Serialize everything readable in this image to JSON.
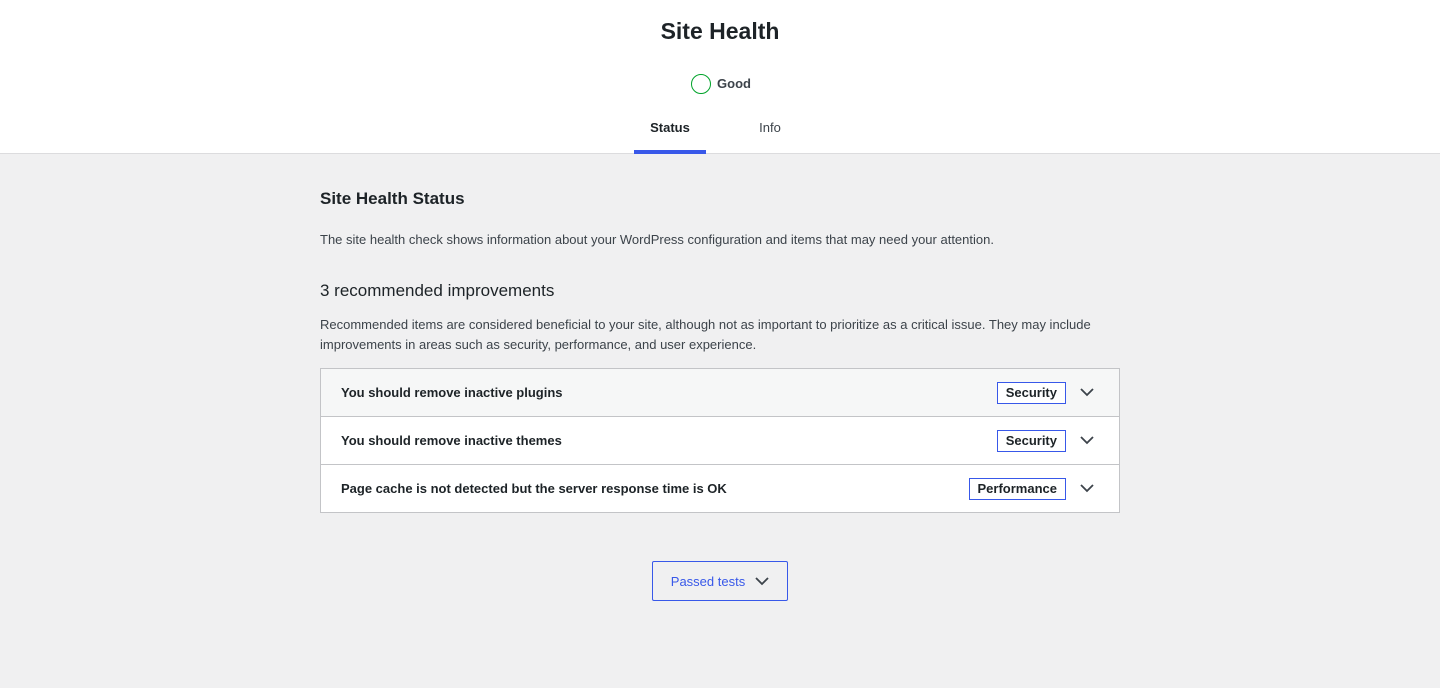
{
  "header": {
    "title": "Site Health",
    "health_status": "Good",
    "health_color": "#00a32a"
  },
  "tabs": [
    {
      "label": "Status",
      "active": true
    },
    {
      "label": "Info",
      "active": false
    }
  ],
  "status": {
    "title": "Site Health Status",
    "description": "The site health check shows information about your WordPress configuration and items that may need your attention."
  },
  "improvements": {
    "heading": "3 recommended improvements",
    "description": "Recommended items are considered beneficial to your site, although not as important to prioritize as a critical issue. They may include improvements in areas such as security, performance, and user experience.",
    "items": [
      {
        "title": "You should remove inactive plugins",
        "badge": "Security",
        "icon": "chevron-down-icon"
      },
      {
        "title": "You should remove inactive themes",
        "badge": "Security",
        "icon": "chevron-down-icon"
      },
      {
        "title": "Page cache is not detected but the server response time is OK",
        "badge": "Performance",
        "icon": "chevron-down-icon"
      }
    ]
  },
  "passed_tests": {
    "label": "Passed tests",
    "icon": "chevron-down-icon"
  },
  "colors": {
    "accent": "#3858e9",
    "good": "#00a32a",
    "background": "#f0f0f1"
  }
}
